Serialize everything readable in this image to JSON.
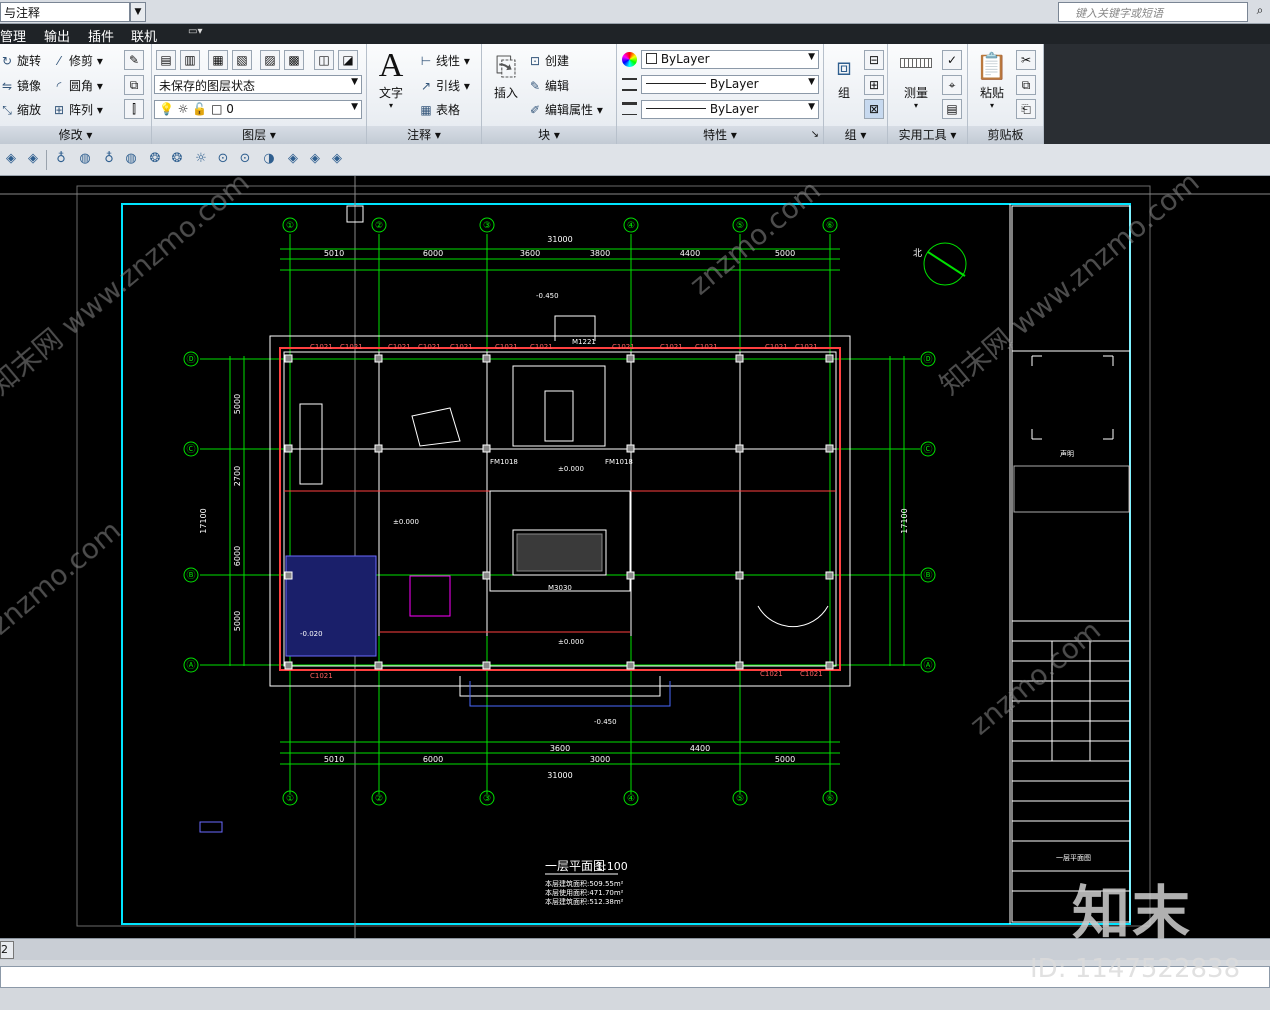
{
  "top": {
    "workspace": "与注释",
    "search_placeholder": "键入关键字或短语"
  },
  "menu": [
    "管理",
    "输出",
    "插件",
    "联机"
  ],
  "ribbon": {
    "modify": {
      "title": "修改",
      "items": [
        "旋转",
        "修剪",
        "镜像",
        "圆角",
        "缩放",
        "阵列"
      ]
    },
    "layers": {
      "title": "图层",
      "layer_state": "未保存的图层状态",
      "current_layer": "0"
    },
    "annotation": {
      "title": "注释",
      "text_button": "文字",
      "items": [
        "线性",
        "引线",
        "表格"
      ]
    },
    "block": {
      "title": "块",
      "insert_button": "插入",
      "items": [
        "创建",
        "编辑",
        "编辑属性"
      ]
    },
    "properties": {
      "title": "特性",
      "color": "ByLayer",
      "linetype": "ByLayer",
      "lineweight": "ByLayer"
    },
    "groups": {
      "title": "组",
      "group_button": "组"
    },
    "utilities": {
      "title": "实用工具",
      "measure_button": "测量"
    },
    "clipboard": {
      "title": "剪贴板",
      "paste_button": "粘贴"
    }
  },
  "drawing": {
    "plan_title": "一层平面图",
    "plan_scale": "1:100",
    "area_lines": [
      "本层建筑面积:509.55m²",
      "本层使用面积:471.70m²",
      "本层建筑面积:512.38m²"
    ],
    "north_label": "北",
    "dimension_total": "31000",
    "dimension_height": "17100",
    "grid_cols": [
      "①",
      "②",
      "③",
      "④",
      "⑤",
      "⑥"
    ],
    "grid_rows": [
      "Ⓓ",
      "Ⓒ",
      "Ⓑ",
      "Ⓐ"
    ],
    "top_dims": [
      "5010",
      "6000",
      "3600",
      "3800",
      "4400",
      "5000"
    ],
    "bottom_dims": [
      "5010",
      "6000",
      "3600",
      "3000",
      "4400",
      "5000"
    ],
    "side_dims": [
      "5000",
      "2700",
      "6000",
      "5000"
    ],
    "window_label": "C1021",
    "door_labels": [
      "FM1018",
      "FM1018",
      "M3030",
      "M1221"
    ],
    "levels": [
      "±0.000",
      "±0.000",
      "±0.000",
      "-0.450",
      "-0.450",
      "-0.020"
    ],
    "title_block": {
      "statement": "声明",
      "sheet_title": "一层平面图"
    }
  },
  "layout_tab": "2",
  "watermark": {
    "logo": "知末",
    "id_text": "ID: 1147522838",
    "site": "znzmo.com",
    "site_cn": "知末网 www.znzmo.com"
  }
}
